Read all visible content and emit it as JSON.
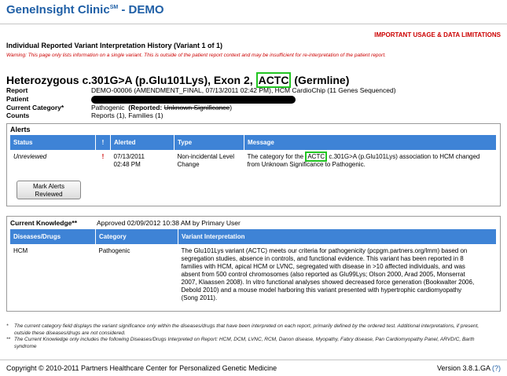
{
  "header": {
    "title_main": "GeneInsight Clinic",
    "title_sm": "SM",
    "title_demo": " - DEMO"
  },
  "limits_link": "IMPORTANT USAGE & DATA LIMITATIONS",
  "history_title": "Individual Reported Variant Interpretation History (Variant 1 of 1)",
  "warning": "Warning: This page only lists information on a single variant. This is outside of the patient report context and may be insufficient for re-interpretation of the patient report.",
  "variant": {
    "prefix": "Heterozygous c.301G>A (p.Glu101Lys), Exon 2,",
    "gene": "ACTC",
    "suffix": "(Germline)"
  },
  "details": {
    "report_label": "Report",
    "report_value": "DEMO-00006 (AMENDMENT_FINAL, 07/13/2011 02:42 PM), HCM CardioChip (11 Genes Sequenced)",
    "patient_label": "Patient",
    "category_label": "Current Category*",
    "category_value": "Pathogenic",
    "reported_label": "(Reported:",
    "reported_value": "Unknown Significance",
    "reported_close": ")",
    "counts_label": "Counts",
    "counts_value": "Reports (1), Families (1)"
  },
  "alerts": {
    "title": "Alerts",
    "headers": {
      "status": "Status",
      "flag": "!",
      "alerted": "Alerted",
      "type": "Type",
      "message": "Message"
    },
    "row": {
      "status": "Unreviewed",
      "flag": "!",
      "date": "07/13/2011",
      "time": "02:48 PM",
      "type": "Non-incidental Level Change",
      "msg_pre": "The category for the",
      "msg_gene": "ACTC",
      "msg_post": "c.301G>A (p.Glu101Lys) association to HCM changed from Unknown Significance to Pathogenic."
    },
    "button": {
      "line1": "Mark Alerts",
      "line2": "Reviewed"
    }
  },
  "knowledge": {
    "title": "Current Knowledge**",
    "approved": "Approved 02/09/2012 10:38 AM by Primary User",
    "headers": {
      "disease": "Diseases/Drugs",
      "category": "Category",
      "interp": "Variant Interpretation"
    },
    "row": {
      "disease": "HCM",
      "category": "Pathogenic",
      "interp": "The Glu101Lys variant (ACTC) meets our criteria for pathogenicity (pcpgm.partners.org/lmm) based on segregation studies, absence in controls, and functional evidence. This variant has been reported in 8 families with HCM, apical HCM or LVNC, segregated with disease in >10 affected individuals, and was absent from 500 control chromosomes (also reported as Glu99Lys; Olson 2000, Arad 2005, Monserrat 2007, Klaassen 2008). In vitro functional analyses showed decreased force generation (Bookwalter 2006, Debold 2010) and a mouse model harboring this variant presented with hypertrophic cardiomyopathy (Song 2011)."
    }
  },
  "footnotes": {
    "m1": "*",
    "n1": "The current category field displays the variant significance only within the diseases/drugs that have been interpreted on each report, primarily defined by the ordered test. Additional interpretations, if present, outside these diseases/drugs are not considered.",
    "m2": "**",
    "n2": "The Current Knowledge only includes the following Diseases/Drugs Interpreted on Report: HCM, DCM, LVNC, RCM, Danon disease, Myopathy, Fabry disease, Pan Cardiomyopathy Panel, ARVD/C, Barth syndrome"
  },
  "footer": {
    "copyright": "Copyright © 2010-2011 Partners Healthcare Center for Personalized Genetic Medicine",
    "version": "Version 3.8.1.GA",
    "help": "(?)"
  },
  "colors": {
    "brand": "#1f5fa6",
    "table_header": "#3e83d6",
    "warning": "#cc0000",
    "highlight": "#22c522"
  }
}
